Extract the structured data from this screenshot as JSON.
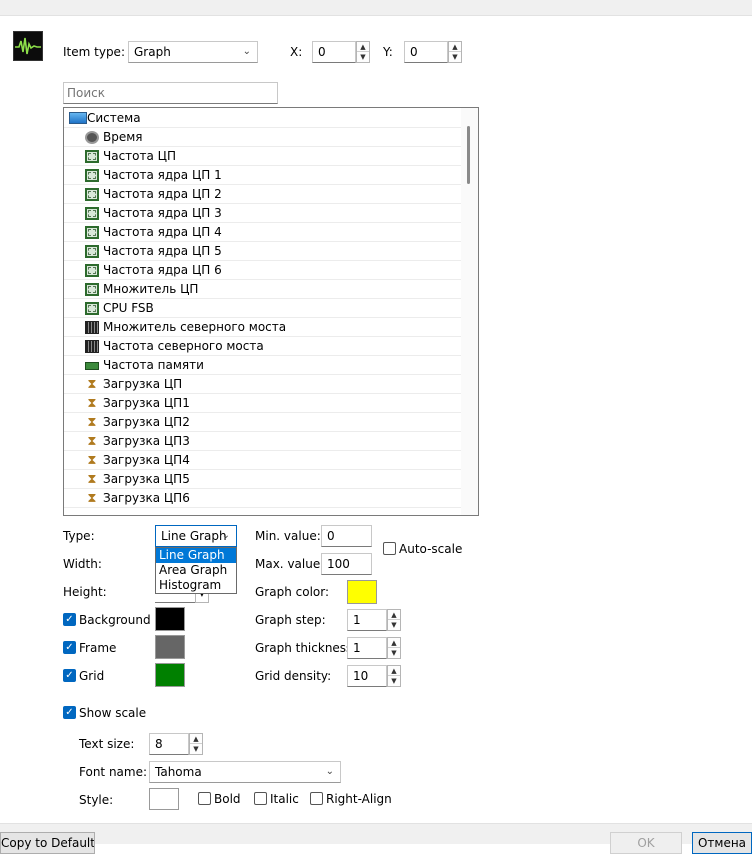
{
  "header": {
    "item_type_label": "Item type:",
    "item_type_value": "Graph",
    "x_label": "X:",
    "x_value": "0",
    "y_label": "Y:",
    "y_value": "0",
    "app_icon": "graph-icon"
  },
  "search": {
    "placeholder": "Поиск"
  },
  "tree": {
    "root_label": "Система",
    "items": [
      {
        "label": "Время",
        "icon": "clock-icon"
      },
      {
        "label": "Частота ЦП",
        "icon": "cpu-icon"
      },
      {
        "label": "Частота ядра ЦП 1",
        "icon": "cpu-icon"
      },
      {
        "label": "Частота ядра ЦП 2",
        "icon": "cpu-icon"
      },
      {
        "label": "Частота ядра ЦП 3",
        "icon": "cpu-icon"
      },
      {
        "label": "Частота ядра ЦП 4",
        "icon": "cpu-icon"
      },
      {
        "label": "Частота ядра ЦП 5",
        "icon": "cpu-icon"
      },
      {
        "label": "Частота ядра ЦП 6",
        "icon": "cpu-icon"
      },
      {
        "label": "Множитель ЦП",
        "icon": "cpu-icon"
      },
      {
        "label": "CPU FSB",
        "icon": "cpu-icon"
      },
      {
        "label": "Множитель северного моста",
        "icon": "chipset-icon"
      },
      {
        "label": "Частота северного моста",
        "icon": "chipset-icon"
      },
      {
        "label": "Частота памяти",
        "icon": "memory-icon"
      },
      {
        "label": "Загрузка ЦП",
        "icon": "hourglass-icon"
      },
      {
        "label": "Загрузка ЦП1",
        "icon": "hourglass-icon"
      },
      {
        "label": "Загрузка ЦП2",
        "icon": "hourglass-icon"
      },
      {
        "label": "Загрузка ЦП3",
        "icon": "hourglass-icon"
      },
      {
        "label": "Загрузка ЦП4",
        "icon": "hourglass-icon"
      },
      {
        "label": "Загрузка ЦП5",
        "icon": "hourglass-icon"
      },
      {
        "label": "Загрузка ЦП6",
        "icon": "hourglass-icon"
      }
    ]
  },
  "graph": {
    "type_label": "Type:",
    "type_value": "Line Graph",
    "type_options": [
      "Line Graph",
      "Area Graph",
      "Histogram"
    ],
    "width_label": "Width:",
    "height_label": "Height:",
    "min_label": "Min. value:",
    "min_value": "0",
    "max_label": "Max. value:",
    "max_value": "100",
    "autoscale_label": "Auto-scale",
    "graph_color_label": "Graph color:",
    "graph_color": "#ffff00",
    "step_label": "Graph step:",
    "step_value": "1",
    "thickness_label": "Graph thickness:",
    "thickness_value": "1",
    "density_label": "Grid density:",
    "density_value": "10"
  },
  "toggles": {
    "background_label": "Background",
    "background_color": "#000000",
    "frame_label": "Frame",
    "frame_color": "#666666",
    "grid_label": "Grid",
    "grid_color": "#008000",
    "show_scale_label": "Show scale"
  },
  "scale": {
    "text_size_label": "Text size:",
    "text_size_value": "8",
    "font_name_label": "Font name:",
    "font_name_value": "Tahoma",
    "style_label": "Style:",
    "bold_label": "Bold",
    "italic_label": "Italic",
    "right_align_label": "Right-Align"
  },
  "footer": {
    "copy_defaults_label": "Copy to Defaults",
    "ok_label": "OK",
    "cancel_label": "Отмена"
  }
}
